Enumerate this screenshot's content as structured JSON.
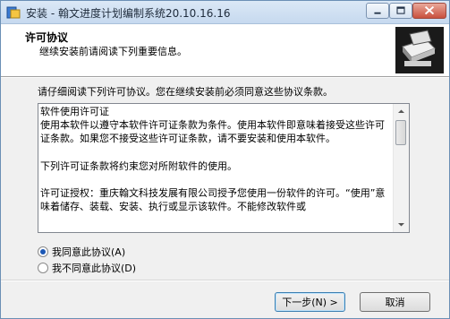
{
  "window": {
    "title": "安装 - 翰文进度计划编制系统20.10.16.16",
    "icon": "installer-icon",
    "controls": [
      "minimize-icon",
      "maximize-icon",
      "close-icon"
    ]
  },
  "header": {
    "title": "许可协议",
    "subtitle": "继续安装前请阅读下列重要信息。",
    "logo": "installer-computer-logo"
  },
  "main": {
    "prompt": "请仔细阅读下列许可协议。您在继续安装前必须同意这些协议条款。",
    "license_text": "软件使用许可证\n使用本软件以遵守本软件许可证条款为条件。使用本软件即意味着接受这些许可证条款。如果您不接受这些许可证条款，请不要安装和使用本软件。\n\n下列许可证条款将约束您对所附软件的使用。\n\n许可证授权：重庆翰文科技发展有限公司授予您使用一份软件的许可。“使用”意味着储存、装载、安装、执行或显示该软件。不能修改软件或"
  },
  "options": {
    "accept": "我同意此协议(A)",
    "decline": "我不同意此协议(D)",
    "selected": "accept"
  },
  "buttons": {
    "next": "下一步(N) >",
    "cancel": "取消"
  },
  "colors": {
    "title_bar": "#c6d9ef",
    "close_button": "#c9503d",
    "radio_checked": "#1c58b5"
  }
}
